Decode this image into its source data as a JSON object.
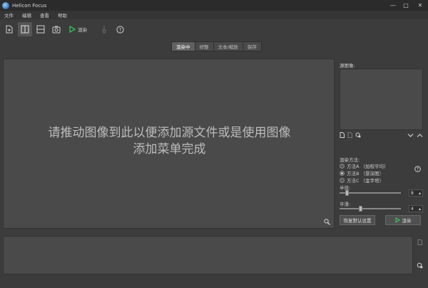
{
  "window": {
    "title": "Helicon Focus",
    "minimize_glyph": "—",
    "maximize_glyph": "□",
    "close_glyph": "✕"
  },
  "menu": {
    "items": [
      "文件",
      "编辑",
      "查看",
      "帮助"
    ]
  },
  "toolbar": {
    "render_label": "渲染",
    "icons": [
      "new-file-icon",
      "split-vertical-icon",
      "split-horizontal-icon",
      "photo-icon",
      "render-play-icon",
      "brush-icon",
      "help-icon"
    ]
  },
  "tabs": [
    {
      "label": "渲染中",
      "active": true
    },
    {
      "label": "修整",
      "active": false
    },
    {
      "label": "文本/缩放",
      "active": false
    },
    {
      "label": "保存",
      "active": false
    }
  ],
  "main": {
    "drop_hint_line1": "请推动图像到此以便添加源文件或是使用图像",
    "drop_hint_line2": "添加菜单完成"
  },
  "side": {
    "source_label": "源图像:",
    "method_label": "渲染方法:",
    "methods": [
      {
        "label": "方法A （加权平均）",
        "selected": false
      },
      {
        "label": "方法B （景深图）",
        "selected": true
      },
      {
        "label": "方法C （金字塔）",
        "selected": false
      }
    ],
    "radius_label": "半径:",
    "radius_value": "8",
    "radius_fraction": 0.1,
    "smoothing_label": "平滑:",
    "smoothing_value": "4",
    "smoothing_fraction": 0.33,
    "reset_button": "恢复默认设置",
    "render_button": "渲染"
  },
  "colors": {
    "accent_green": "#39c05a",
    "panel": "#4a4a4a",
    "background": "#3c3c3c"
  }
}
